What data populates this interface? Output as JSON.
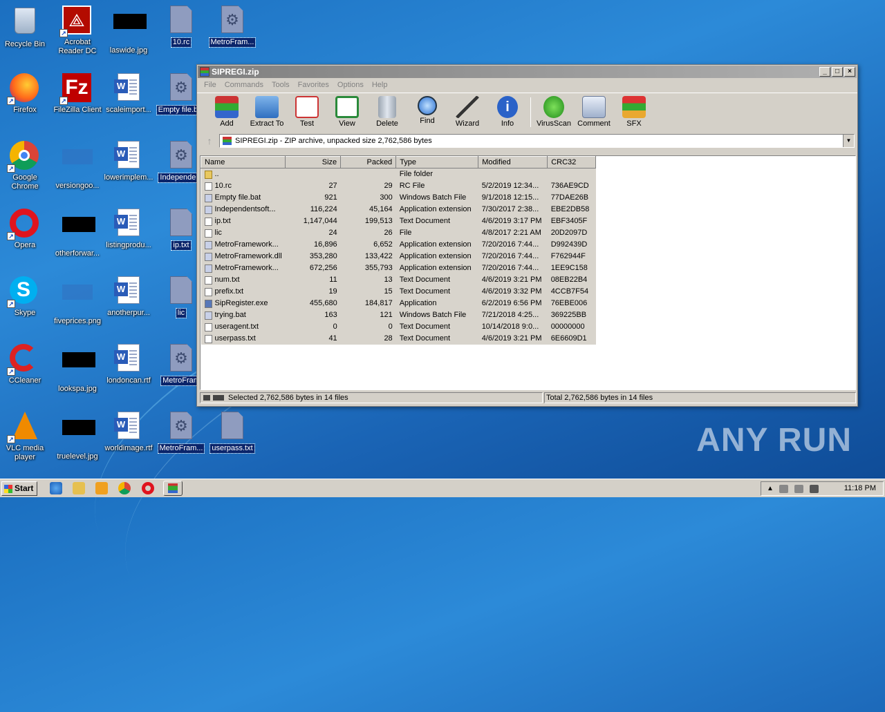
{
  "desktop": {
    "icons": [
      {
        "label": "Recycle Bin"
      },
      {
        "label": "Acrobat Reader DC"
      },
      {
        "label": "laswide.jpg"
      },
      {
        "label": "10.rc"
      },
      {
        "label": "MetroFram..."
      },
      {
        "label": "Firefox"
      },
      {
        "label": "FileZilla Client"
      },
      {
        "label": "scaleimport..."
      },
      {
        "label": "Empty file.b..."
      },
      {
        "label": "Google Chrome"
      },
      {
        "label": "versiongoo..."
      },
      {
        "label": "lowerimplem..."
      },
      {
        "label": "Independe..."
      },
      {
        "label": "Opera"
      },
      {
        "label": "otherforwar..."
      },
      {
        "label": "listingprodu..."
      },
      {
        "label": "ip.txt"
      },
      {
        "label": "Skype"
      },
      {
        "label": "fiveprices.png"
      },
      {
        "label": "anotherpur..."
      },
      {
        "label": "lic"
      },
      {
        "label": "CCleaner"
      },
      {
        "label": "lookspa.jpg"
      },
      {
        "label": "londoncan.rtf"
      },
      {
        "label": "MetroFram"
      },
      {
        "label": "VLC media player"
      },
      {
        "label": "truelevel.jpg"
      },
      {
        "label": "worldimage.rtf"
      },
      {
        "label": "MetroFram..."
      },
      {
        "label": "userpass.txt"
      }
    ]
  },
  "window": {
    "title": "SIPREGI.zip",
    "menu": [
      "File",
      "Commands",
      "Tools",
      "Favorites",
      "Options",
      "Help"
    ],
    "toolbar": [
      "Add",
      "Extract To",
      "Test",
      "View",
      "Delete",
      "Find",
      "Wizard",
      "Info",
      "VirusScan",
      "Comment",
      "SFX"
    ],
    "address": "SIPREGI.zip - ZIP archive, unpacked size 2,762,586 bytes",
    "columns": [
      "Name",
      "Size",
      "Packed",
      "Type",
      "Modified",
      "CRC32"
    ],
    "files": [
      {
        "name": "..",
        "size": "",
        "packed": "",
        "type": "File folder",
        "modified": "",
        "crc": ""
      },
      {
        "name": "10.rc",
        "size": "27",
        "packed": "29",
        "type": "RC File",
        "modified": "5/2/2019 12:34...",
        "crc": "736AE9CD"
      },
      {
        "name": "Empty file.bat",
        "size": "921",
        "packed": "300",
        "type": "Windows Batch File",
        "modified": "9/1/2018 12:15...",
        "crc": "77DAE26B"
      },
      {
        "name": "Independentsoft...",
        "size": "116,224",
        "packed": "45,164",
        "type": "Application extension",
        "modified": "7/30/2017 2:38...",
        "crc": "EBE2DB58"
      },
      {
        "name": "ip.txt",
        "size": "1,147,044",
        "packed": "199,513",
        "type": "Text Document",
        "modified": "4/6/2019 3:17 PM",
        "crc": "EBF3405F"
      },
      {
        "name": "lic",
        "size": "24",
        "packed": "26",
        "type": "File",
        "modified": "4/8/2017 2:21 AM",
        "crc": "20D2097D"
      },
      {
        "name": "MetroFramework...",
        "size": "16,896",
        "packed": "6,652",
        "type": "Application extension",
        "modified": "7/20/2016 7:44...",
        "crc": "D992439D"
      },
      {
        "name": "MetroFramework.dll",
        "size": "353,280",
        "packed": "133,422",
        "type": "Application extension",
        "modified": "7/20/2016 7:44...",
        "crc": "F762944F"
      },
      {
        "name": "MetroFramework...",
        "size": "672,256",
        "packed": "355,793",
        "type": "Application extension",
        "modified": "7/20/2016 7:44...",
        "crc": "1EE9C158"
      },
      {
        "name": "num.txt",
        "size": "11",
        "packed": "13",
        "type": "Text Document",
        "modified": "4/6/2019 3:21 PM",
        "crc": "08EB22B4"
      },
      {
        "name": "prefix.txt",
        "size": "19",
        "packed": "15",
        "type": "Text Document",
        "modified": "4/6/2019 3:32 PM",
        "crc": "4CCB7F54"
      },
      {
        "name": "SipRegister.exe",
        "size": "455,680",
        "packed": "184,817",
        "type": "Application",
        "modified": "6/2/2019 6:56 PM",
        "crc": "76EBE006"
      },
      {
        "name": "trying.bat",
        "size": "163",
        "packed": "121",
        "type": "Windows Batch File",
        "modified": "7/21/2018 4:25...",
        "crc": "369225BB"
      },
      {
        "name": "useragent.txt",
        "size": "0",
        "packed": "0",
        "type": "Text Document",
        "modified": "10/14/2018 9:0...",
        "crc": "00000000"
      },
      {
        "name": "userpass.txt",
        "size": "41",
        "packed": "28",
        "type": "Text Document",
        "modified": "4/6/2019 3:21 PM",
        "crc": "6E6609D1"
      }
    ],
    "status_left": "Selected 2,762,586 bytes in 14 files",
    "status_right": "Total 2,762,586 bytes in 14 files"
  },
  "taskbar": {
    "start": "Start",
    "clock": "11:18 PM"
  },
  "watermark": "ANY RUN"
}
